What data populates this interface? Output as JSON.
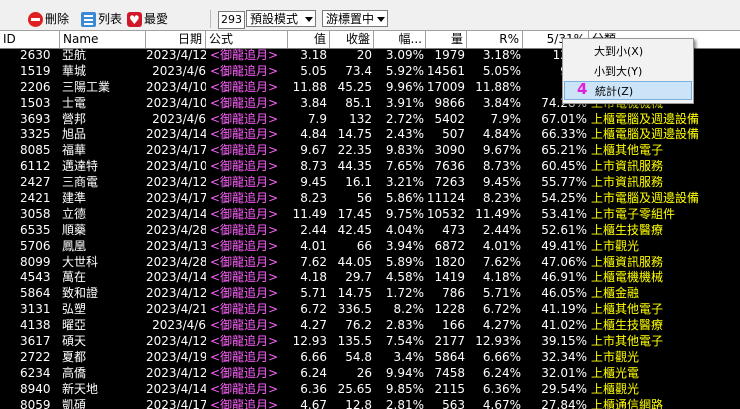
{
  "toolbar": {
    "delete_label": "刪除",
    "list_label": "列表",
    "favorite_label": "最愛",
    "count": "293",
    "format_select": "預設模式",
    "cursor_select": "游標置中"
  },
  "columns": [
    "ID",
    "Name",
    "日期",
    "公式",
    "值",
    "收盤",
    "幅...",
    "量",
    "R%",
    "5/31%",
    "分類"
  ],
  "rows": [
    {
      "id": "2630",
      "name": "亞航",
      "date": "2023/4/12",
      "formula": "<御龍追月>",
      "val": "3.18",
      "close": "20",
      "pct": "3.09%",
      "vol": "1979",
      "r": "3.18%",
      "p531": "129.5",
      "cat": ""
    },
    {
      "id": "1519",
      "name": "華城",
      "date": "2023/4/6",
      "formula": "<御龍追月>",
      "val": "5.05",
      "close": "73.4",
      "pct": "5.92%",
      "vol": "14561",
      "r": "5.05%",
      "p531": "96.6",
      "cat": ""
    },
    {
      "id": "2206",
      "name": "三陽工業",
      "date": "2023/4/10",
      "formula": "<御龍追月>",
      "val": "11.88",
      "close": "45.25",
      "pct": "9.96%",
      "vol": "17009",
      "r": "11.88%",
      "p531": "75.",
      "cat": ""
    },
    {
      "id": "1503",
      "name": "士電",
      "date": "2023/4/10",
      "formula": "<御龍追月>",
      "val": "3.84",
      "close": "85.1",
      "pct": "3.91%",
      "vol": "9866",
      "r": "3.84%",
      "p531": "74.28%",
      "cat": "上市電機機械"
    },
    {
      "id": "3693",
      "name": "營邦",
      "date": "2023/4/6",
      "formula": "<御龍追月>",
      "val": "7.9",
      "close": "132",
      "pct": "2.72%",
      "vol": "5402",
      "r": "7.9%",
      "p531": "67.01%",
      "cat": "上櫃電腦及週邊設備"
    },
    {
      "id": "3325",
      "name": "旭品",
      "date": "2023/4/14",
      "formula": "<御龍追月>",
      "val": "4.84",
      "close": "14.75",
      "pct": "2.43%",
      "vol": "507",
      "r": "4.84%",
      "p531": "66.33%",
      "cat": "上櫃電腦及週邊設備"
    },
    {
      "id": "8085",
      "name": "福華",
      "date": "2023/4/17",
      "formula": "<御龍追月>",
      "val": "9.67",
      "close": "22.35",
      "pct": "9.83%",
      "vol": "3090",
      "r": "9.67%",
      "p531": "65.21%",
      "cat": "上櫃其他電子"
    },
    {
      "id": "6112",
      "name": "邁達特",
      "date": "2023/4/10",
      "formula": "<御龍追月>",
      "val": "8.73",
      "close": "44.35",
      "pct": "7.65%",
      "vol": "7636",
      "r": "8.73%",
      "p531": "60.45%",
      "cat": "上市資訊服務"
    },
    {
      "id": "2427",
      "name": "三商電",
      "date": "2023/4/12",
      "formula": "<御龍追月>",
      "val": "9.45",
      "close": "16.1",
      "pct": "3.21%",
      "vol": "7263",
      "r": "9.45%",
      "p531": "55.77%",
      "cat": "上市資訊服務"
    },
    {
      "id": "2421",
      "name": "建準",
      "date": "2023/4/17",
      "formula": "<御龍追月>",
      "val": "8.23",
      "close": "56",
      "pct": "5.86%",
      "vol": "11124",
      "r": "8.23%",
      "p531": "54.25%",
      "cat": "上市電腦及週邊設備"
    },
    {
      "id": "3058",
      "name": "立德",
      "date": "2023/4/14",
      "formula": "<御龍追月>",
      "val": "11.49",
      "close": "17.45",
      "pct": "9.75%",
      "vol": "10532",
      "r": "11.49%",
      "p531": "53.41%",
      "cat": "上市電子零組件"
    },
    {
      "id": "6535",
      "name": "順藥",
      "date": "2023/4/28",
      "formula": "<御龍追月>",
      "val": "2.44",
      "close": "42.45",
      "pct": "4.04%",
      "vol": "473",
      "r": "2.44%",
      "p531": "52.61%",
      "cat": "上櫃生技醫療"
    },
    {
      "id": "5706",
      "name": "鳳凰",
      "date": "2023/4/13",
      "formula": "<御龍追月>",
      "val": "4.01",
      "close": "66",
      "pct": "3.94%",
      "vol": "6872",
      "r": "4.01%",
      "p531": "49.41%",
      "cat": "上市觀光"
    },
    {
      "id": "8099",
      "name": "大世科",
      "date": "2023/4/28",
      "formula": "<御龍追月>",
      "val": "7.62",
      "close": "44.05",
      "pct": "5.89%",
      "vol": "1820",
      "r": "7.62%",
      "p531": "47.06%",
      "cat": "上櫃資訊服務"
    },
    {
      "id": "4543",
      "name": "萬在",
      "date": "2023/4/14",
      "formula": "<御龍追月>",
      "val": "4.18",
      "close": "29.7",
      "pct": "4.58%",
      "vol": "1419",
      "r": "4.18%",
      "p531": "46.91%",
      "cat": "上櫃電機機械"
    },
    {
      "id": "5864",
      "name": "致和證",
      "date": "2023/4/12",
      "formula": "<御龍追月>",
      "val": "5.71",
      "close": "14.75",
      "pct": "1.72%",
      "vol": "786",
      "r": "5.71%",
      "p531": "46.05%",
      "cat": "上櫃金融"
    },
    {
      "id": "3131",
      "name": "弘塑",
      "date": "2023/4/21",
      "formula": "<御龍追月>",
      "val": "6.72",
      "close": "336.5",
      "pct": "8.2%",
      "vol": "1228",
      "r": "6.72%",
      "p531": "41.19%",
      "cat": "上櫃其他電子"
    },
    {
      "id": "4138",
      "name": "曜亞",
      "date": "2023/4/6",
      "formula": "<御龍追月>",
      "val": "4.27",
      "close": "76.2",
      "pct": "2.83%",
      "vol": "166",
      "r": "4.27%",
      "p531": "41.02%",
      "cat": "上櫃生技醫療"
    },
    {
      "id": "3617",
      "name": "碩天",
      "date": "2023/4/12",
      "formula": "<御龍追月>",
      "val": "12.93",
      "close": "135.5",
      "pct": "7.54%",
      "vol": "2177",
      "r": "12.93%",
      "p531": "39.15%",
      "cat": "上市其他電子"
    },
    {
      "id": "2722",
      "name": "夏都",
      "date": "2023/4/19",
      "formula": "<御龍追月>",
      "val": "6.66",
      "close": "54.8",
      "pct": "3.4%",
      "vol": "5864",
      "r": "6.66%",
      "p531": "32.34%",
      "cat": "上市觀光"
    },
    {
      "id": "6234",
      "name": "高僑",
      "date": "2023/4/12",
      "formula": "<御龍追月>",
      "val": "6.24",
      "close": "26",
      "pct": "9.94%",
      "vol": "7458",
      "r": "6.24%",
      "p531": "32.01%",
      "cat": "上櫃光電"
    },
    {
      "id": "8940",
      "name": "新天地",
      "date": "2023/4/14",
      "formula": "<御龍追月>",
      "val": "6.36",
      "close": "25.65",
      "pct": "9.85%",
      "vol": "2115",
      "r": "6.36%",
      "p531": "29.54%",
      "cat": "上櫃觀光"
    },
    {
      "id": "8059",
      "name": "凱碩",
      "date": "2023/4/17",
      "formula": "<御龍追月>",
      "val": "4.67",
      "close": "12.8",
      "pct": "2.81%",
      "vol": "563",
      "r": "4.67%",
      "p531": "27.84%",
      "cat": "上櫃通信網路"
    }
  ],
  "context_menu": {
    "items": [
      {
        "label": "大到小(X)"
      },
      {
        "label": "小到大(Y)"
      },
      {
        "label": "統計(Z)"
      }
    ],
    "marker": "4"
  },
  "colors": {
    "background": "#000000",
    "text": "#ffffff",
    "category": "#ffff00",
    "formula": "#ff60ff"
  }
}
